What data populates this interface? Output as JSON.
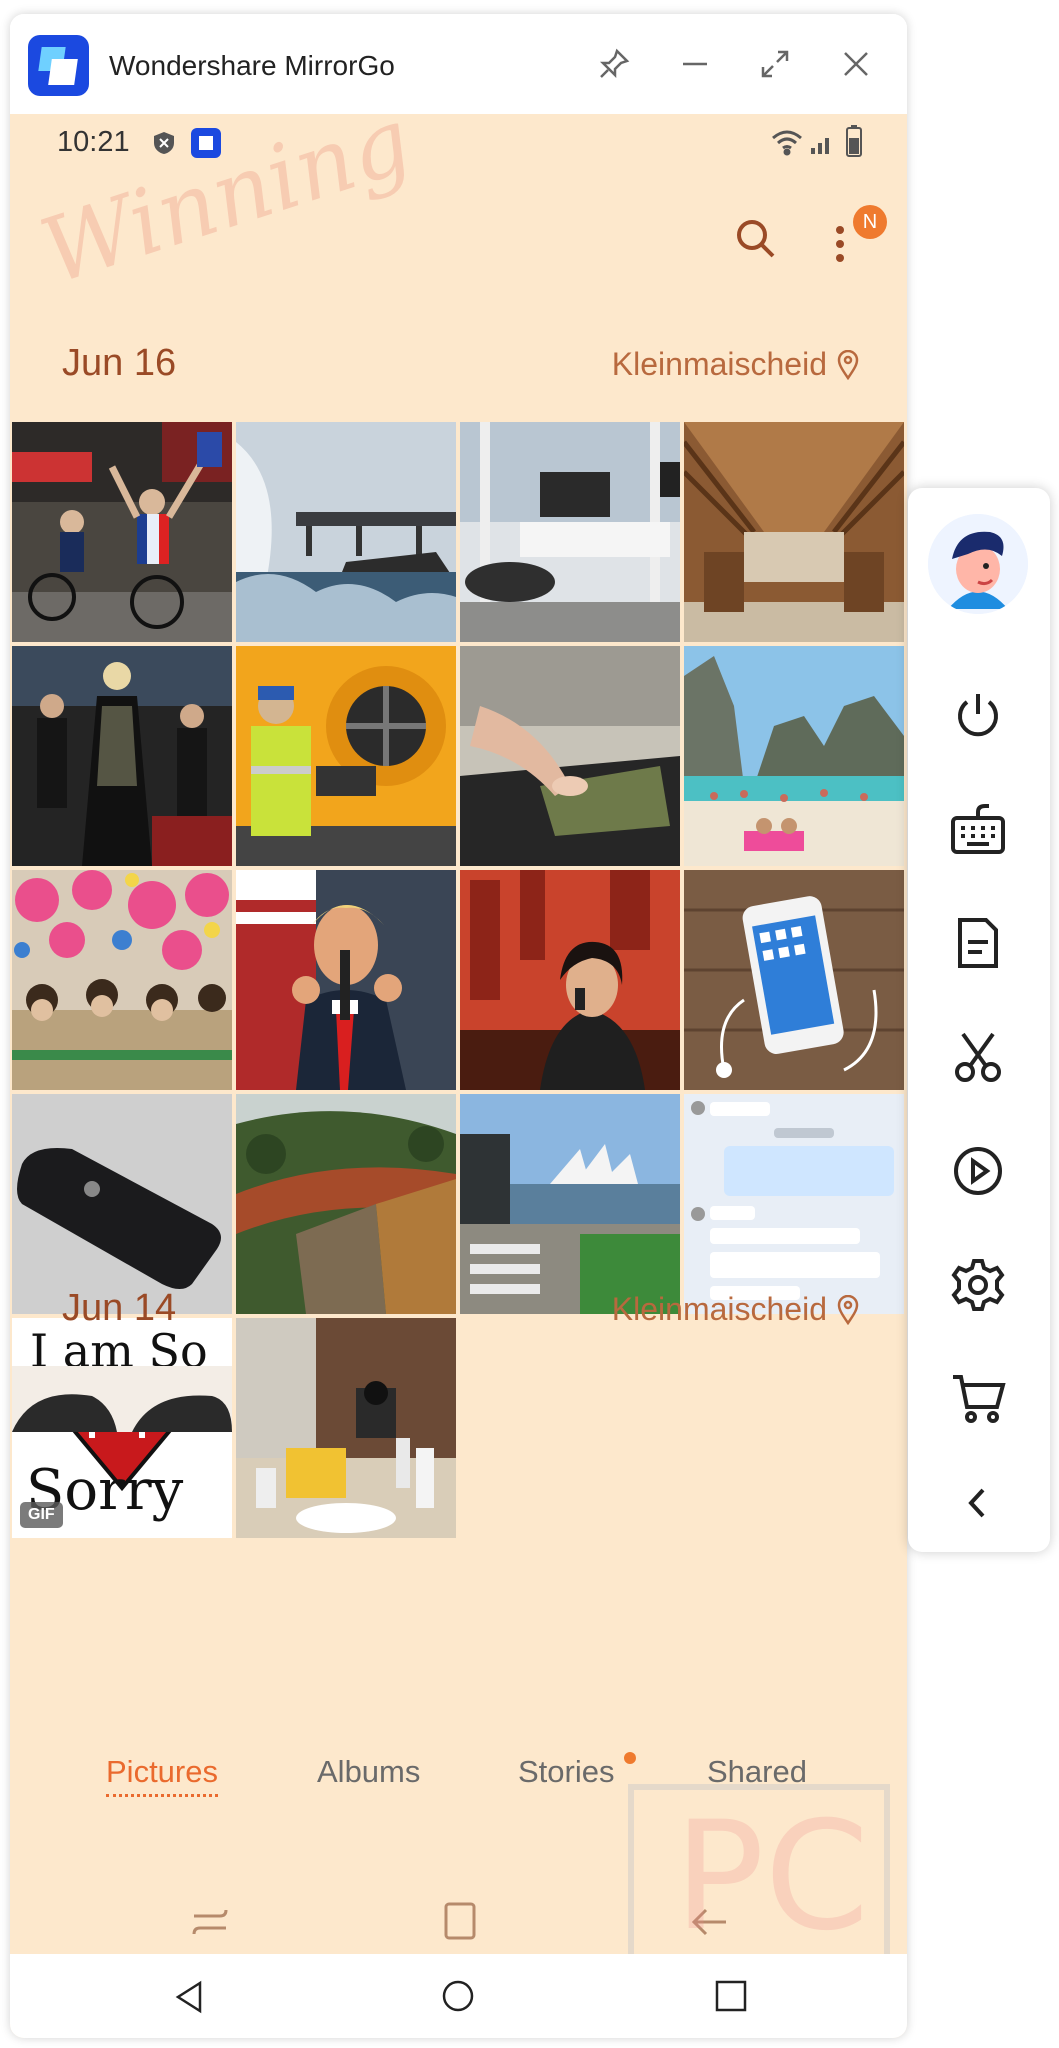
{
  "window": {
    "title": "Wondershare MirrorGo"
  },
  "status": {
    "time": "10:21"
  },
  "sections": [
    {
      "date": "Jun 16",
      "location": "Kleinmaischeid"
    },
    {
      "date": "Jun 14",
      "location": "Kleinmaischeid"
    }
  ],
  "header": {
    "notification_badge": "N"
  },
  "photos": [
    {
      "name": "cycling-race"
    },
    {
      "name": "waves-pier"
    },
    {
      "name": "living-room"
    },
    {
      "name": "wood-atrium"
    },
    {
      "name": "red-carpet"
    },
    {
      "name": "worker-machine"
    },
    {
      "name": "hand-wallet"
    },
    {
      "name": "beach-cliffs"
    },
    {
      "name": "children-balloons"
    },
    {
      "name": "speaker-podium"
    },
    {
      "name": "woman-phone-red"
    },
    {
      "name": "smartphone-earphones"
    },
    {
      "name": "black-phone"
    },
    {
      "name": "train-bridge"
    },
    {
      "name": "opera-house"
    },
    {
      "name": "chat-screenshot"
    },
    {
      "name": "sorry-heart-gif",
      "text_lines": [
        "I am So",
        "Sorry"
      ],
      "badge": "GIF"
    },
    {
      "name": "mirror-selfie"
    }
  ],
  "tabs": {
    "pictures": "Pictures",
    "albums": "Albums",
    "stories": "Stories",
    "shared": "Shared",
    "active": "Pictures"
  },
  "colors": {
    "accent": "#ea6a2e",
    "background": "#fde8cc",
    "date_text": "#9a4a26"
  },
  "sidebar_icons": [
    "avatar",
    "power-icon",
    "keyboard-icon",
    "document-icon",
    "scissors-icon",
    "play-icon",
    "gear-icon",
    "cart-icon",
    "chevron-left-icon"
  ]
}
